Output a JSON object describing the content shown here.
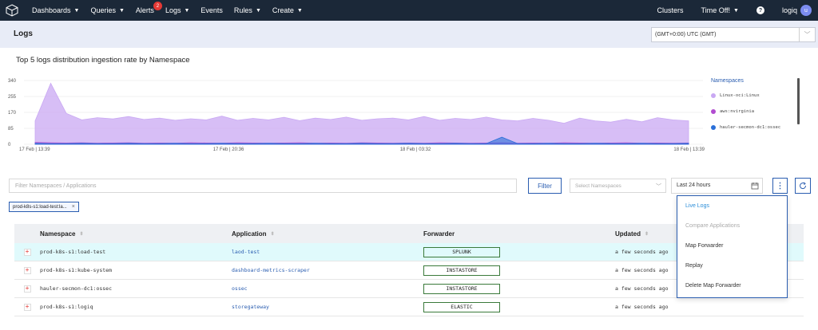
{
  "nav": {
    "items": [
      {
        "label": "Dashboards",
        "caret": true
      },
      {
        "label": "Queries",
        "caret": true
      },
      {
        "label": "Alerts",
        "caret": false,
        "badge": "2"
      },
      {
        "label": "Logs",
        "caret": true
      },
      {
        "label": "Events",
        "caret": false
      },
      {
        "label": "Rules",
        "caret": true
      },
      {
        "label": "Create",
        "caret": true
      }
    ],
    "right": {
      "clusters": "Clusters",
      "time_off": "Time Off!",
      "help": "?",
      "user": "logiq",
      "avatar": "u"
    }
  },
  "header": {
    "title": "Logs",
    "timezone": "(GMT+0:00) UTC (GMT)"
  },
  "chart_data": {
    "type": "area",
    "title": "Top 5 logs distribution ingestion rate by Namespace",
    "x_tick_labels": [
      "17 Feb | 13:39",
      "17 Feb | 20:36",
      "18 Feb | 03:32",
      "18 Feb | 13:39"
    ],
    "y_ticks": [
      0,
      85,
      170,
      255,
      340
    ],
    "ylim": [
      0,
      340
    ],
    "legend_title": "Namespaces",
    "legend_position": "right",
    "series": [
      {
        "name": "Linux-oci:Linux",
        "color": "#c9a8f3",
        "values": [
          125,
          325,
          165,
          130,
          142,
          135,
          148,
          132,
          140,
          128,
          136,
          130,
          150,
          128,
          138,
          130,
          144,
          126,
          140,
          132,
          145,
          128,
          136,
          140,
          130,
          148,
          128,
          138,
          132,
          145,
          130,
          125,
          138,
          128,
          112,
          140,
          125,
          118,
          133,
          120,
          142,
          130,
          125
        ]
      },
      {
        "name": "aws:nvirginia",
        "color": "#b14cd0",
        "values": [
          10,
          8,
          7,
          8,
          6,
          7,
          8,
          6,
          7,
          6,
          8,
          7,
          6,
          8,
          7,
          6,
          7,
          8,
          6,
          7,
          6,
          8,
          7,
          6,
          7,
          6,
          8,
          7,
          6,
          7,
          8,
          6,
          7,
          6,
          8,
          7,
          6,
          7,
          8,
          6,
          7,
          6,
          7
        ]
      },
      {
        "name": "hauler-secmon-dc1:ossec",
        "color": "#2a6fd8",
        "values": [
          5,
          4,
          4,
          5,
          4,
          4,
          5,
          4,
          4,
          5,
          4,
          4,
          5,
          4,
          4,
          5,
          4,
          4,
          5,
          4,
          4,
          5,
          4,
          4,
          5,
          4,
          4,
          5,
          4,
          4,
          38,
          4,
          4,
          5,
          4,
          4,
          5,
          4,
          4,
          5,
          4,
          4,
          5
        ]
      }
    ]
  },
  "filters": {
    "namespace_placeholder": "Filter Namespaces / Applications",
    "filter_button": "Filter",
    "select_namespaces_placeholder": "Select Namespaces",
    "time_range": "Last 24 hours",
    "more_icon": "⋮",
    "active_tag": "prod-k8s-s1:load-test:la...",
    "tag_close": "×"
  },
  "table": {
    "columns": [
      "Namespace",
      "Application",
      "Forwarder",
      "Updated"
    ],
    "rows": [
      {
        "namespace": "prod-k8s-s1:load-test",
        "application": "laod-test",
        "forwarder": "SPLUNK",
        "updated": "a few seconds ago",
        "highlighted": true
      },
      {
        "namespace": "prod-k8s-s1:kube-system",
        "application": "dashboard-metrics-scraper",
        "forwarder": "INSTASTORE",
        "updated": "a few seconds ago",
        "highlighted": false
      },
      {
        "namespace": "hauler-secmon-dc1:ossec",
        "application": "ossec",
        "forwarder": "INSTASTORE",
        "updated": "a few seconds ago",
        "highlighted": false
      },
      {
        "namespace": "prod-k8s-s1:logiq",
        "application": "storegateway",
        "forwarder": "ELASTIC",
        "updated": "a few seconds ago",
        "highlighted": false
      }
    ]
  },
  "menu": {
    "items": [
      {
        "label": "Live Logs",
        "state": "active"
      },
      {
        "label": "Compare Applications",
        "state": "disabled"
      },
      {
        "label": "Map Forwarder",
        "state": "normal"
      },
      {
        "label": "Replay",
        "state": "normal"
      },
      {
        "label": "Delete Map Forwarder",
        "state": "normal"
      }
    ]
  }
}
